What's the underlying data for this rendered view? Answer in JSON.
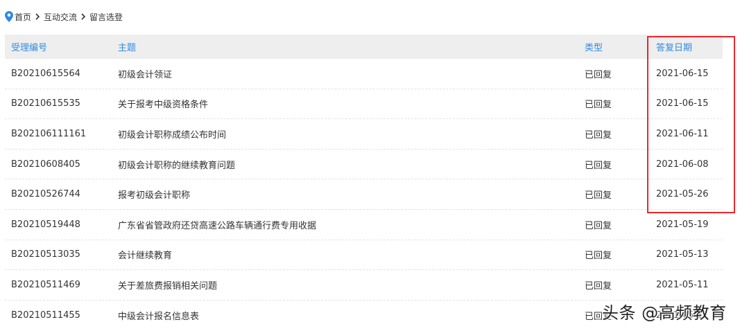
{
  "breadcrumb": {
    "items": [
      "首页",
      "互动交流",
      "留言选登"
    ]
  },
  "table": {
    "headers": {
      "id": "受理编号",
      "subject": "主题",
      "type": "类型",
      "date": "答复日期"
    },
    "rows": [
      {
        "id": "B20210615564",
        "subject": "初级会计领证",
        "type": "已回复",
        "date": "2021-06-15"
      },
      {
        "id": "B20210615535",
        "subject": "关于报考中级资格条件",
        "type": "已回复",
        "date": "2021-06-15"
      },
      {
        "id": "B202106111161",
        "subject": "初级会计职称成绩公布时间",
        "type": "已回复",
        "date": "2021-06-11"
      },
      {
        "id": "B20210608405",
        "subject": "初级会计职称的继续教育问题",
        "type": "已回复",
        "date": "2021-06-08"
      },
      {
        "id": "B20210526744",
        "subject": "报考初级会计职称",
        "type": "已回复",
        "date": "2021-05-26"
      },
      {
        "id": "B20210519448",
        "subject": "广东省省管政府还贷高速公路车辆通行费专用收据",
        "type": "已回复",
        "date": "2021-05-19"
      },
      {
        "id": "B20210513035",
        "subject": "会计继续教育",
        "type": "已回复",
        "date": "2021-05-13"
      },
      {
        "id": "B20210511469",
        "subject": "关于差旅费报销相关问题",
        "type": "已回复",
        "date": "2021-05-11"
      },
      {
        "id": "B20210511455",
        "subject": "中级会计报名信息表",
        "type": "已回复",
        "date": "2021-05-11"
      }
    ]
  },
  "watermark": "头条 @高频教育",
  "colors": {
    "header_text": "#2d8ae6",
    "header_bg": "#eeeeee",
    "highlight_border": "#e8262b",
    "pin_icon": "#2d8ae6"
  },
  "icons": {
    "breadcrumb_home": "location-pin-icon",
    "breadcrumb_separator": "chevron-right-icon"
  }
}
